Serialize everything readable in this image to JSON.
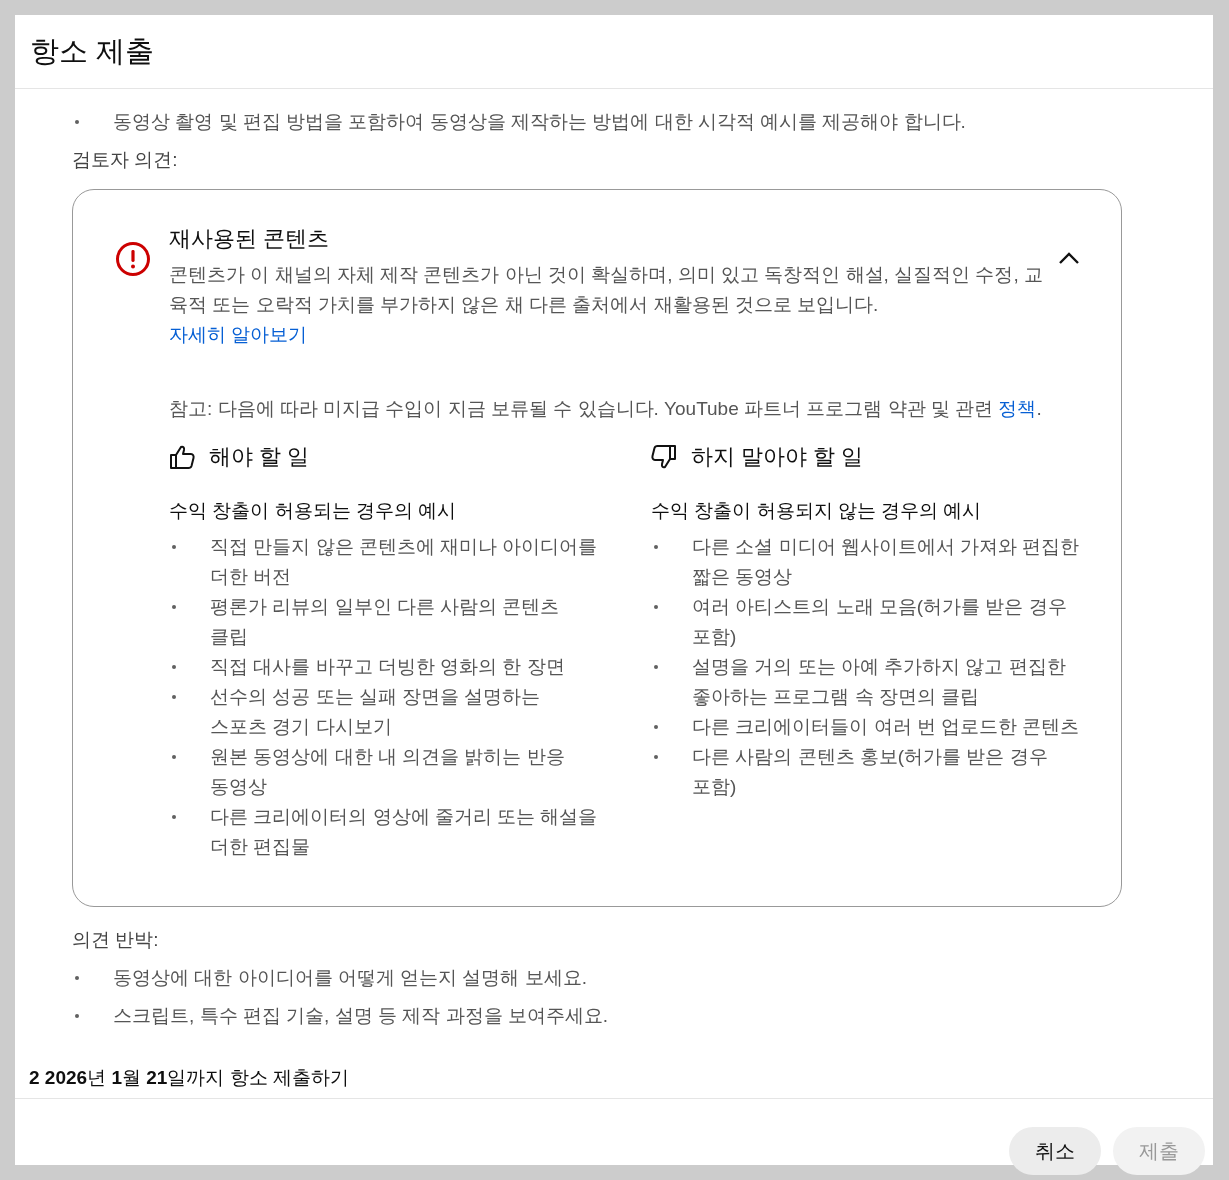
{
  "dialog": {
    "title": "항소 제출"
  },
  "guidance_bullets": [
    "동영상 촬영 및 편집 방법을 포함하여 동영상을 제작하는 방법에 대한 시각적 예시를 제공해야 합니다."
  ],
  "reviewer_label": "검토자 의견:",
  "policy_card": {
    "title": "재사용된 콘텐츠",
    "expanded": true,
    "description": "콘텐츠가 이 채널의 자체 제작 콘텐츠가 아닌 것이 확실하며, 의미 있고 독창적인 해설, 실질적인 수정, 교육적 또는 오락적 가치를 부가하지 않은 채 다른 출처에서 재활용된 것으로 보입니다.",
    "learn_more": "자세히 알아보기",
    "note": "참고: 다음에 따라 미지급 수입이 지금 보류될 수 있습니다. YouTube 파트너 프로그램 약관 및 관련",
    "note_link": "정책",
    "note_end": ".",
    "columns": [
      {
        "kind": "do",
        "heading": "해야 할 일",
        "subheading": "수익 창출이 허용되는 경우의 예시",
        "items": [
          "직접 만들지 않은 콘텐츠에 재미나 아이디어를 더한 버전",
          "평론가 리뷰의 일부인 다른 사람의 콘텐츠 클립",
          "직접 대사를 바꾸고 더빙한 영화의 한 장면",
          "선수의 성공 또는 실패 장면을 설명하는 스포츠 경기 다시보기",
          "원본 동영상에 대한 내 의견을 밝히는 반응 동영상",
          "다른 크리에이터의 영상에 줄거리 또는 해설을 더한 편집물"
        ]
      },
      {
        "kind": "dont",
        "heading": "하지 말아야 할 일",
        "subheading": "수익 창출이 허용되지 않는 경우의 예시",
        "items": [
          "다른 소셜 미디어 웹사이트에서 가져와 편집한 짧은 동영상",
          "여러 아티스트의 노래 모음(허가를 받은 경우 포함)",
          "설명을 거의 또는 아예 추가하지 않고 편집한 좋아하는 프로그램 속 장면의 클립",
          "다른 크리에이터들이 여러 번 업로드한 콘텐츠",
          "다른 사람의 콘텐츠 홍보(허가를 받은 경우 포함)"
        ]
      }
    ]
  },
  "rebuttal_label": "의견 반박:",
  "rebuttal_bullets": [
    "동영상에 대한 아이디어를 어떻게 얻는지 설명해 보세요.",
    "스크립트, 특수 편집 기술, 설명 등 제작 과정을 보여주세요."
  ],
  "deadline": "**2 2026**년 **1**월 **21**일까지 항소 제출하기",
  "buttons": [
    {
      "label": "취소",
      "disabled": false
    },
    {
      "label": "제출",
      "disabled": true
    }
  ]
}
